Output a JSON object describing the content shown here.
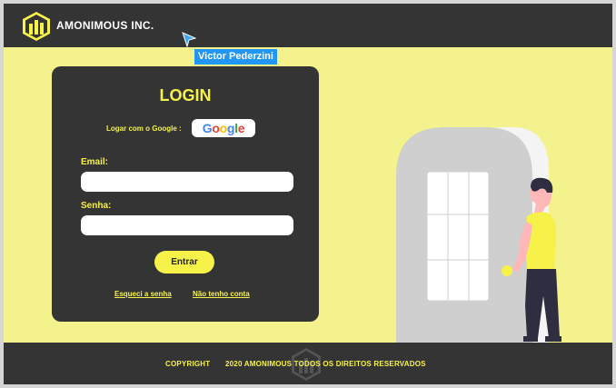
{
  "header": {
    "brand": "AMONIMOUS INC.",
    "logo_icon": "building-logo-icon"
  },
  "presence": {
    "user_name": "Victor Pederzini",
    "color": "#2196f3"
  },
  "login": {
    "title": "LOGIN",
    "google_label": "Logar com o Google :",
    "google_button": {
      "g1": "G",
      "o1": "o",
      "o2": "o",
      "g2": "g",
      "l": "l",
      "e": "e"
    },
    "email_label": "Email:",
    "email_value": "",
    "password_label": "Senha:",
    "password_value": "",
    "submit_label": "Entrar",
    "forgot_link": "Esqueci a senha",
    "no_account_link": "Não tenho conta"
  },
  "footer": {
    "copyright": "COPYRIGHT",
    "text": "2020 AMONIMOUS TODOS OS DIREITOS RESERVADOS"
  },
  "colors": {
    "accent": "#f6f24a",
    "background": "#f3f28d",
    "dark": "#343434"
  }
}
